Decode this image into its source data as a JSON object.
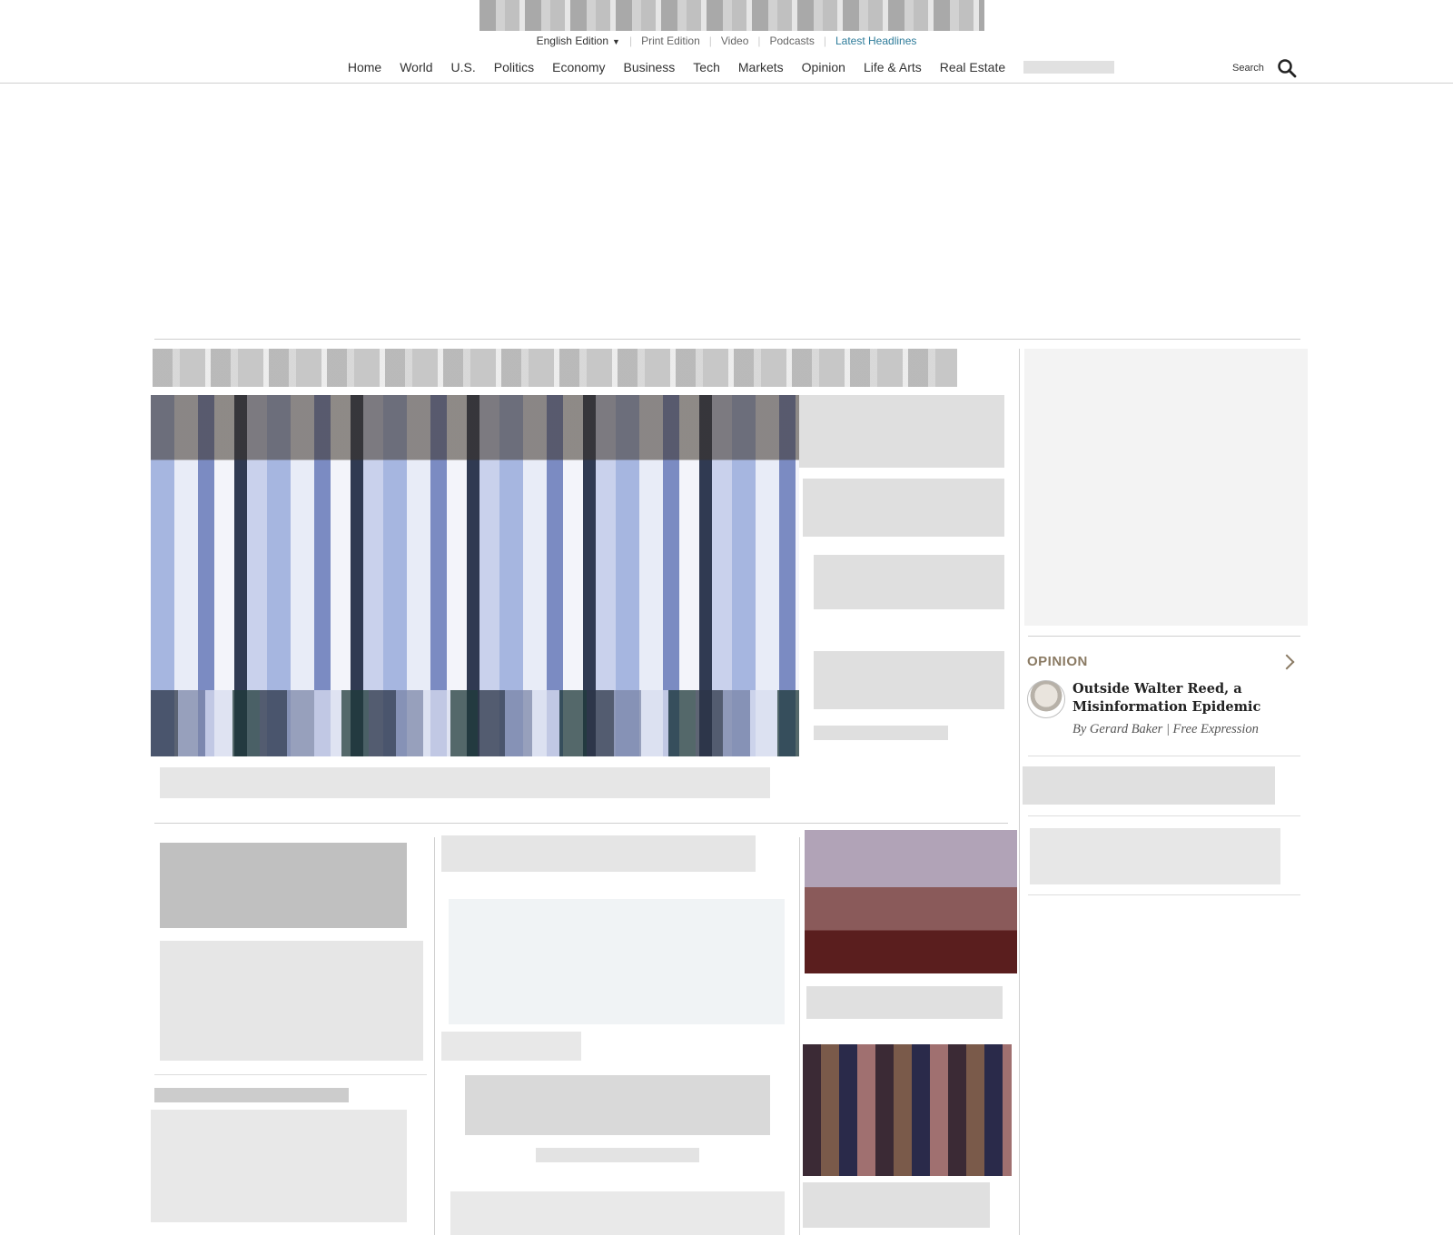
{
  "header": {
    "edition": "English Edition",
    "links": [
      "Print Edition",
      "Video",
      "Podcasts"
    ],
    "latest": "Latest Headlines",
    "nav": [
      "Home",
      "World",
      "U.S.",
      "Politics",
      "Economy",
      "Business",
      "Tech",
      "Markets",
      "Opinion",
      "Life & Arts",
      "Real Estate"
    ],
    "search_label": "Search"
  },
  "opinion": {
    "section_label": "OPINION",
    "headline": "Outside Walter Reed, a Misinformation Epidemic",
    "byline": "By Gerard Baker | Free Expression"
  },
  "colors": {
    "accent_link": "#2e7c9a",
    "opinion_label": "#8a7a63"
  }
}
